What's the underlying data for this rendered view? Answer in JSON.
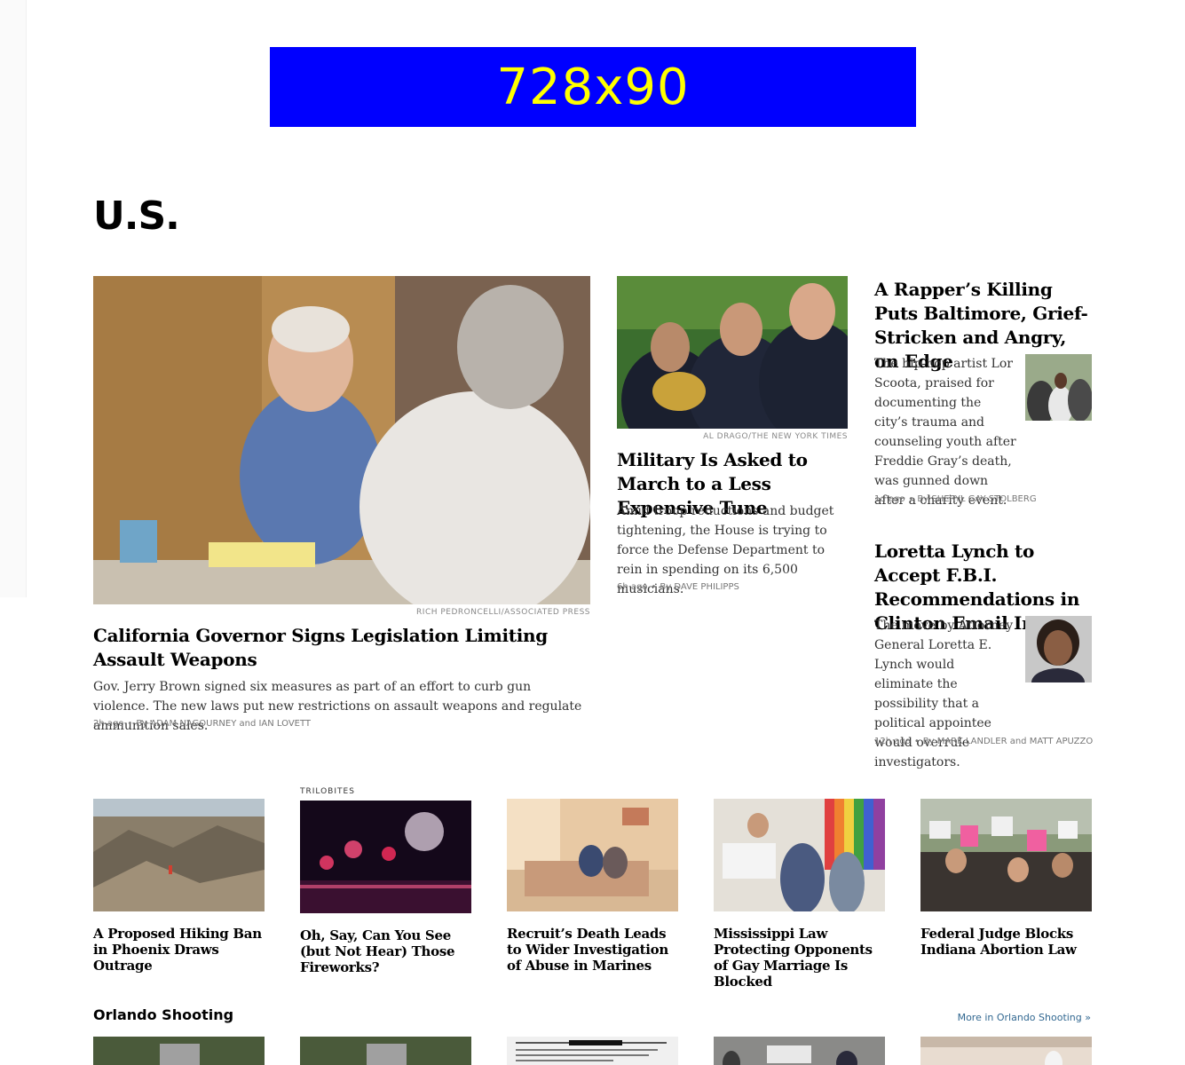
{
  "ad": {
    "label": "728x90"
  },
  "section": {
    "title": "U.S."
  },
  "lead": {
    "credit": "RICH PEDRONCELLI/ASSOCIATED PRESS",
    "headline": "California Governor Signs Legislation Limiting Assault Weapons",
    "summary": "Gov. Jerry Brown signed six measures as part of an effort to curb gun violence. The new laws put new restrictions on assault weapons and regulate ammunition sales.",
    "time": "2h ago",
    "byline": "By ADAM NAGOURNEY and IAN LOVETT"
  },
  "second": {
    "credit": "AL DRAGO/THE NEW YORK TIMES",
    "headline": "Military Is Asked to March to a Less Expensive Tune",
    "summary": "Amid troop reductions and budget tightening, the House is trying to force the Defense Department to rein in spending on its 6,500 musicians.",
    "time": "6h ago",
    "byline": "By DAVE PHILIPPS"
  },
  "third": {
    "headline": "A Rapper’s Killing Puts Baltimore, Grief-Stricken and Angry, on Edge",
    "summary": "The hip-hop artist Lor Scoota, praised for documenting the city’s trauma and counseling youth after Freddie Gray’s death, was gunned down after a charity event.",
    "time": "1d ago",
    "byline": "By SHERYL GAY STOLBERG"
  },
  "fourth": {
    "headline": "Loretta Lynch to Accept F.B.I. Recommendations in Clinton Email Inquiry",
    "summary": "The move by Attorney General Loretta E. Lynch would eliminate the possibility that a political appointee would overrule investigators.",
    "time": "12h ago",
    "byline": "By MARK LANDLER and MATT APUZZO"
  },
  "row": [
    {
      "kicker": "",
      "headline": "A Proposed Hiking Ban in Phoenix Draws Outrage"
    },
    {
      "kicker": "TRILOBITES",
      "headline": "Oh, Say, Can You See (but Not Hear) Those Fireworks?"
    },
    {
      "kicker": "",
      "headline": "Recruit’s Death Leads to Wider Investigation of Abuse in Marines"
    },
    {
      "kicker": "",
      "headline": "Mississippi Law Protecting Opponents of Gay Marriage Is Blocked"
    },
    {
      "kicker": "",
      "headline": "Federal Judge Blocks Indiana Abortion Law"
    }
  ],
  "orlando": {
    "title": "Orlando Shooting",
    "more": "More in Orlando Shooting »"
  },
  "colors": {
    "ad_bg": "#0000ff",
    "ad_text": "#ffff00",
    "link": "#326891"
  }
}
